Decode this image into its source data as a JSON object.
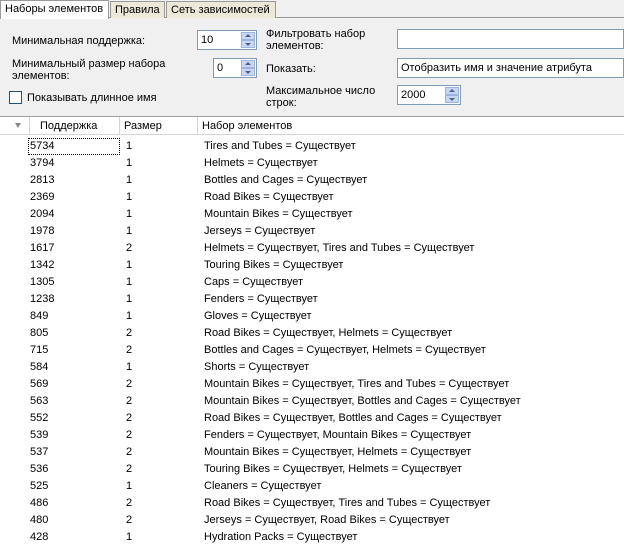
{
  "tabs": [
    {
      "label": "Наборы элементов"
    },
    {
      "label": "Правила"
    },
    {
      "label": "Сеть зависимостей"
    }
  ],
  "settings": {
    "min_support_label": "Минимальная поддержка:",
    "min_support_value": "10",
    "min_itemset_size_label_1": "Минимальный размер набора",
    "min_itemset_size_label_2": "элементов:",
    "min_itemset_size_value": "0",
    "show_long_name_label": "Показывать длинное имя",
    "filter_label_1": "Фильтровать набор",
    "filter_label_2": "элементов:",
    "filter_value": "",
    "show_label": "Показать:",
    "show_value": "Отобразить имя и значение атрибута",
    "max_rows_label_1": "Максимальное число",
    "max_rows_label_2": "строк:",
    "max_rows_value": "2000"
  },
  "grid": {
    "columns": [
      "Поддержка",
      "Размер",
      "Набор элементов"
    ],
    "rows": [
      {
        "support": "5734",
        "size": "1",
        "items": "Tires and Tubes = Существует"
      },
      {
        "support": "3794",
        "size": "1",
        "items": "Helmets = Существует"
      },
      {
        "support": "2813",
        "size": "1",
        "items": "Bottles and Cages = Существует"
      },
      {
        "support": "2369",
        "size": "1",
        "items": "Road Bikes = Существует"
      },
      {
        "support": "2094",
        "size": "1",
        "items": "Mountain Bikes = Существует"
      },
      {
        "support": "1978",
        "size": "1",
        "items": "Jerseys = Существует"
      },
      {
        "support": "1617",
        "size": "2",
        "items": "Helmets = Существует, Tires and Tubes = Существует"
      },
      {
        "support": "1342",
        "size": "1",
        "items": "Touring Bikes = Существует"
      },
      {
        "support": "1305",
        "size": "1",
        "items": "Caps = Существует"
      },
      {
        "support": "1238",
        "size": "1",
        "items": "Fenders = Существует"
      },
      {
        "support": "849",
        "size": "1",
        "items": "Gloves = Существует"
      },
      {
        "support": "805",
        "size": "2",
        "items": "Road Bikes = Существует, Helmets = Существует"
      },
      {
        "support": "715",
        "size": "2",
        "items": "Bottles and Cages = Существует, Helmets = Существует"
      },
      {
        "support": "584",
        "size": "1",
        "items": "Shorts = Существует"
      },
      {
        "support": "569",
        "size": "2",
        "items": "Mountain Bikes = Существует, Tires and Tubes = Существует"
      },
      {
        "support": "563",
        "size": "2",
        "items": "Mountain Bikes = Существует, Bottles and Cages = Существует"
      },
      {
        "support": "552",
        "size": "2",
        "items": "Road Bikes = Существует, Bottles and Cages = Существует"
      },
      {
        "support": "539",
        "size": "2",
        "items": "Fenders = Существует, Mountain Bikes = Существует"
      },
      {
        "support": "537",
        "size": "2",
        "items": "Mountain Bikes = Существует, Helmets = Существует"
      },
      {
        "support": "536",
        "size": "2",
        "items": "Touring Bikes = Существует, Helmets = Существует"
      },
      {
        "support": "525",
        "size": "1",
        "items": "Cleaners = Существует"
      },
      {
        "support": "486",
        "size": "2",
        "items": "Road Bikes = Существует, Tires and Tubes = Существует"
      },
      {
        "support": "480",
        "size": "2",
        "items": "Jerseys = Существует, Road Bikes = Существует"
      },
      {
        "support": "428",
        "size": "1",
        "items": "Hydration Packs = Существует"
      }
    ]
  }
}
